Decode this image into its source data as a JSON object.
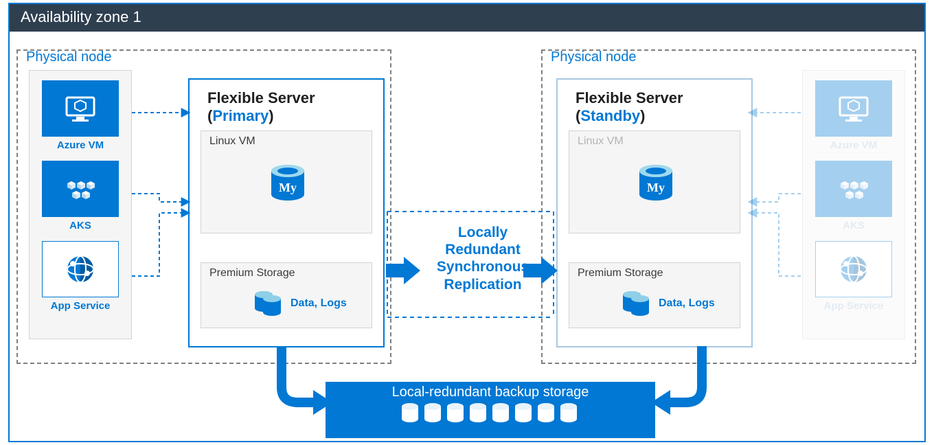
{
  "zone": {
    "title": "Availability zone 1"
  },
  "left_node": {
    "label": "Physical node",
    "services": [
      {
        "name": "Azure VM",
        "icon": "vm"
      },
      {
        "name": "AKS",
        "icon": "aks"
      },
      {
        "name": "App Service",
        "icon": "appservice"
      }
    ],
    "server": {
      "title_prefix": "Flexible Server (",
      "role": "Primary",
      "title_suffix": ")",
      "vm_label": "Linux VM",
      "storage_label": "Premium Storage",
      "data_label": "Data, Logs"
    }
  },
  "replication": {
    "line1": "Locally",
    "line2": "Redundant",
    "line3": "Synchronous",
    "line4": "Replication"
  },
  "right_node": {
    "label": "Physical node",
    "services": [
      {
        "name": "Azure VM",
        "icon": "vm"
      },
      {
        "name": "AKS",
        "icon": "aks"
      },
      {
        "name": "App Service",
        "icon": "appservice"
      }
    ],
    "server": {
      "title_prefix": "Flexible Server (",
      "role": "Standby",
      "title_suffix": ")",
      "vm_label": "Linux VM",
      "storage_label": "Premium Storage",
      "data_label": "Data, Logs"
    }
  },
  "backup": {
    "title": "Local-redundant backup storage"
  },
  "colors": {
    "azure_blue": "#0078d4",
    "header_bg": "#2e3f50"
  }
}
